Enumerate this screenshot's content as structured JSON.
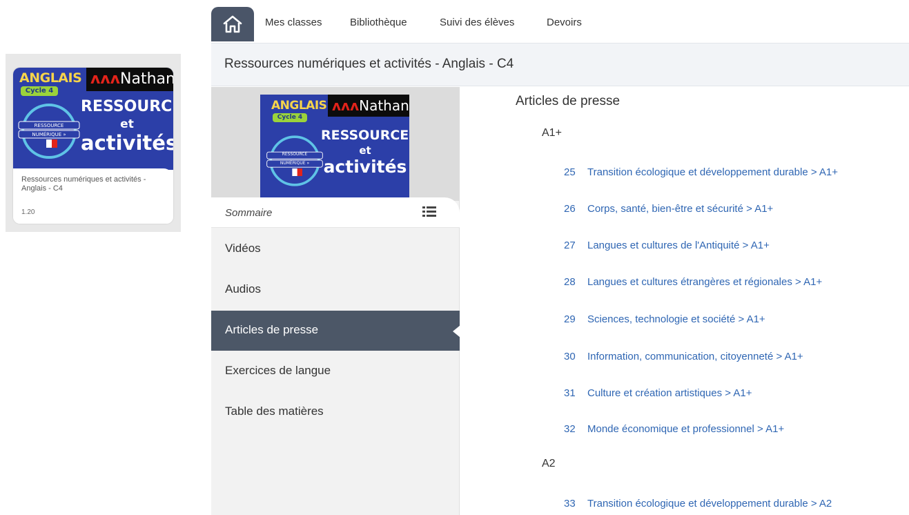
{
  "card": {
    "title": "Ressources numériques et activités - Anglais - C4",
    "version": "1.20"
  },
  "cover": {
    "subject": "ANGLAIS",
    "cycle": "Cycle 4",
    "publisher": "Nathan",
    "line1": "RESSOURCES",
    "line2": "et",
    "line3": "activités",
    "badge_top": "RESSOURCE",
    "badge_bottom": "NUMÉRIQUE »"
  },
  "nav": {
    "home_icon": "home-icon",
    "items": [
      "Mes classes",
      "Bibliothèque",
      "Suivi des élèves",
      "Devoirs"
    ]
  },
  "title": "Ressources numériques et activités - Anglais - C4",
  "sidebar": {
    "sommaire": "Sommaire",
    "items": [
      "Vidéos",
      "Audios",
      "Articles de presse",
      "Exercices de langue",
      "Table des matières"
    ],
    "active_index": 2
  },
  "main": {
    "title": "Articles de presse",
    "levels": [
      {
        "label": "A1+",
        "entries": [
          {
            "num": "25",
            "text": "Transition écologique et développement durable > A1+"
          },
          {
            "num": "26",
            "text": "Corps, santé, bien-être et sécurité > A1+"
          },
          {
            "num": "27",
            "text": "Langues et cultures de l'Antiquité > A1+"
          },
          {
            "num": "28",
            "text": "Langues et cultures étrangères et régionales > A1+"
          },
          {
            "num": "29",
            "text": "Sciences, technologie et société > A1+"
          },
          {
            "num": "30",
            "text": "Information, communication, citoyenneté > A1+"
          },
          {
            "num": "31",
            "text": "Culture et création artistiques > A1+"
          },
          {
            "num": "32",
            "text": "Monde économique et professionnel > A1+"
          }
        ]
      },
      {
        "label": "A2",
        "entries": [
          {
            "num": "33",
            "text": "Transition écologique et développement durable > A2"
          }
        ]
      }
    ]
  },
  "colors": {
    "accent_dark": "#4c5767",
    "link": "#2f66b3",
    "cover_blue": "#2c3fa8",
    "cover_yellow": "#f6d44a",
    "cover_green": "#9bd33b",
    "nathan_red": "#e2231a"
  }
}
